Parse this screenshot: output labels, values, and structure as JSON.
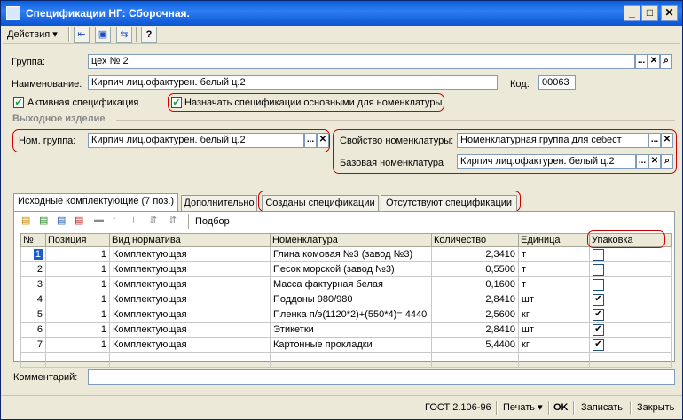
{
  "window": {
    "title": "Спецификации НГ: Сборочная.",
    "minimize": "_",
    "maximize": "□",
    "close": "✕"
  },
  "toolbar": {
    "actions": "Действия",
    "actions_arrow": "▾",
    "btn1": "⇤",
    "btn2": "▣",
    "btn3": "⇆",
    "help": "?"
  },
  "form": {
    "group_label": "Группа:",
    "group_value": "цех № 2",
    "name_label": "Наименование:",
    "name_value": "Кирпич лиц.офактурен. белый ц.2",
    "code_label": "Код:",
    "code_value": "00063",
    "active_spec_label": "Активная спецификация",
    "active_spec_checked": true,
    "assign_main_label": "Назначать спецификации основными для номенклатуры",
    "assign_main_checked": true,
    "output_section": "Выходное изделие",
    "nom_group_label": "Ном. группа:",
    "nom_group_value": "Кирпич лиц.офактурен. белый ц.2",
    "property_label": "Свойство номенклатуры:",
    "property_value": "Номенклатурная группа для себест",
    "base_nom_label": "Базовая номенклатура",
    "base_nom_value": "Кирпич лиц.офактурен. белый ц.2",
    "dots": "...",
    "clear": "✕",
    "search": "🔍"
  },
  "tabs": [
    {
      "label": "Исходные комплектующие (7 поз.)"
    },
    {
      "label": "Дополнительно"
    },
    {
      "label": "Созданы спецификации"
    },
    {
      "label": "Отсутствуют спецификации"
    }
  ],
  "table_toolbar": {
    "pick": "Подбор"
  },
  "table": {
    "headers": [
      "№",
      "Позиция",
      "Вид норматива",
      "Номенклатура",
      "Количество",
      "Единица",
      "Упаковка"
    ],
    "rows": [
      {
        "n": "1",
        "pos": "1",
        "type": "Комплектующая",
        "nom": "Глина комовая №3 (завод №3)",
        "qty": "2,3410",
        "unit": "т",
        "pack": false
      },
      {
        "n": "2",
        "pos": "1",
        "type": "Комплектующая",
        "nom": "Песок морской (завод №3)",
        "qty": "0,5500",
        "unit": "т",
        "pack": false
      },
      {
        "n": "3",
        "pos": "1",
        "type": "Комплектующая",
        "nom": "Масса фактурная белая",
        "qty": "0,1600",
        "unit": "т",
        "pack": false
      },
      {
        "n": "4",
        "pos": "1",
        "type": "Комплектующая",
        "nom": "Поддоны 980/980",
        "qty": "2,8410",
        "unit": "шт",
        "pack": true
      },
      {
        "n": "5",
        "pos": "1",
        "type": "Комплектующая",
        "nom": "Пленка п/э(1120*2)+(550*4)= 4440",
        "qty": "2,5600",
        "unit": "кг",
        "pack": true
      },
      {
        "n": "6",
        "pos": "1",
        "type": "Комплектующая",
        "nom": "Этикетки",
        "qty": "2,8410",
        "unit": "шт",
        "pack": true
      },
      {
        "n": "7",
        "pos": "1",
        "type": "Комплектующая",
        "nom": "Картонные прокладки",
        "qty": "5,4400",
        "unit": "кг",
        "pack": true
      }
    ]
  },
  "comment_label": "Комментарий:",
  "comment_value": "",
  "footer": {
    "gost": "ГОСТ 2.106-96",
    "print": "Печать",
    "print_arrow": "▾",
    "ok": "OK",
    "save": "Записать",
    "close": "Закрыть"
  },
  "colors": {
    "titlebar": "#0a5fdc",
    "highlight": "#cc0000",
    "selection": "#1a5bd0"
  }
}
